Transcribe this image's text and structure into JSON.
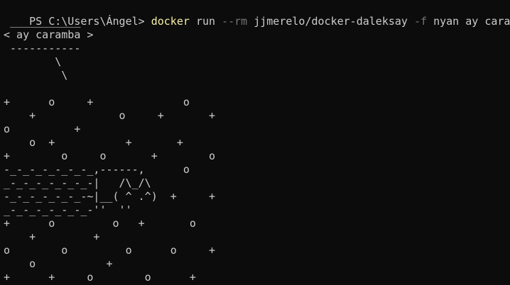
{
  "terminal": {
    "prompt": "PS C:\\Users\\Ángel> ",
    "command": {
      "program": "docker",
      "subcommand": "run",
      "flag_rm": "--rm",
      "image": "jjmerelo/docker-daleksay",
      "flag_f": "-f",
      "args": "nyan ay caramba"
    },
    "output_lines": [
      " ___________",
      "< ay caramba >",
      " -----------",
      "        \\",
      "         \\",
      "",
      "+      o     +              o",
      "    +             o     +       +",
      "o          +",
      "    o  +           +       +",
      "+        o     o       +        o",
      "-_-_-_-_-_-_-_,------,      o",
      "_-_-_-_-_-_-_-|   /\\_/\\",
      "-_-_-_-_-_-_-~|__( ^ .^)  +     +",
      "_-_-_-_-_-_-_-''  ''",
      "+      o         o   +       o",
      "    +         +",
      "o        o         o      o     +",
      "    o           +",
      "+      +     o        o      +"
    ]
  }
}
